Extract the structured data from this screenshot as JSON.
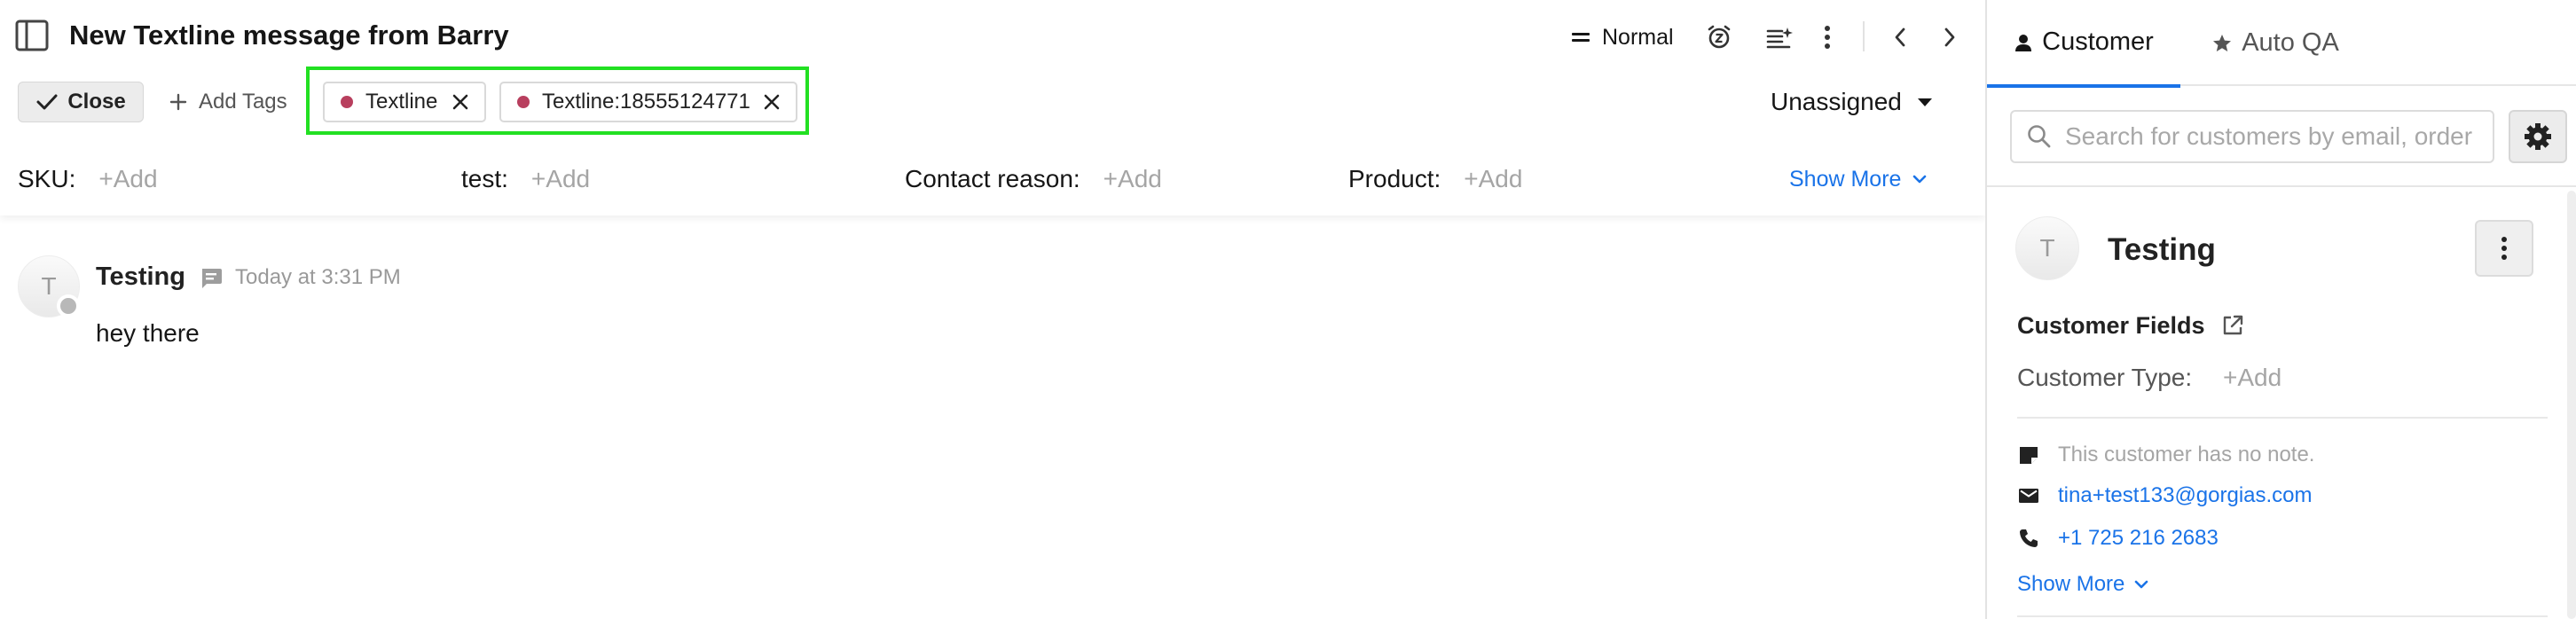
{
  "ticket": {
    "title": "New Textline message from Barry",
    "priority": "Normal",
    "close_label": "Close",
    "add_tags_label": "Add Tags",
    "tags": [
      {
        "label": "Textline",
        "color": "#b83f5e"
      },
      {
        "label": "Textline:18555124771",
        "color": "#b83f5e"
      }
    ],
    "assignee": "Unassigned"
  },
  "fields": [
    {
      "label": "SKU:",
      "value": "+Add"
    },
    {
      "label": "test:",
      "value": "+Add"
    },
    {
      "label": "Contact reason:",
      "value": "+Add"
    },
    {
      "label": "Product:",
      "value": "+Add"
    }
  ],
  "show_more": "Show More",
  "message": {
    "avatar_letter": "T",
    "author": "Testing",
    "time": "Today at 3:31 PM",
    "body": "hey there"
  },
  "panel": {
    "tabs": [
      {
        "label": "Customer",
        "icon": "person-icon",
        "active": true
      },
      {
        "label": "Auto QA",
        "icon": "star-icon",
        "active": false
      }
    ],
    "search_placeholder": "Search for customers by email, order",
    "customer": {
      "avatar_letter": "T",
      "name": "Testing",
      "fields_title": "Customer Fields",
      "customer_type_label": "Customer Type:",
      "customer_type_value": "+Add",
      "note": "This customer has no note.",
      "email": "tina+test133@gorgias.com",
      "phone": "+1 725 216 2683",
      "show_more": "Show More"
    }
  },
  "colors": {
    "accent": "#1a73e8",
    "tag_dot": "#b83f5e",
    "highlight": "#22e022"
  }
}
